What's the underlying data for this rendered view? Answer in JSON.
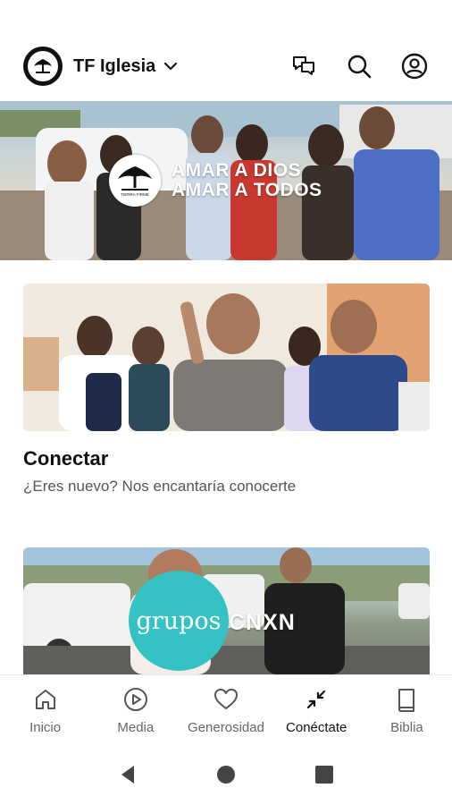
{
  "header": {
    "org_name": "TF Iglesia",
    "icons": [
      "logo-icon",
      "chevron-down-icon",
      "chat-icon",
      "search-icon",
      "account-icon"
    ]
  },
  "hero": {
    "logo_text": "TIERRA FIRME",
    "line1": "AMAR A DIOS",
    "line2": "AMAR A TODOS"
  },
  "cards": [
    {
      "title": "Conectar",
      "subtitle": "¿Eres nuevo? Nos encantaría conocerte"
    },
    {
      "title": "",
      "subtitle": "",
      "image_text_grupos": "grupos",
      "image_text_cnxn": "CNXN"
    }
  ],
  "bottom_nav": {
    "items": [
      {
        "label": "Inicio",
        "icon": "home-icon"
      },
      {
        "label": "Media",
        "icon": "play-icon"
      },
      {
        "label": "Generosidad",
        "icon": "heart-icon"
      },
      {
        "label": "Conéctate",
        "icon": "connect-icon",
        "active": true
      },
      {
        "label": "Biblia",
        "icon": "book-icon"
      }
    ]
  },
  "system_nav": [
    "back-icon",
    "home-circle-icon",
    "recents-icon"
  ],
  "colors": {
    "accent_teal": "#35c2c4",
    "text_dark": "#111111",
    "text_muted": "#555555"
  }
}
